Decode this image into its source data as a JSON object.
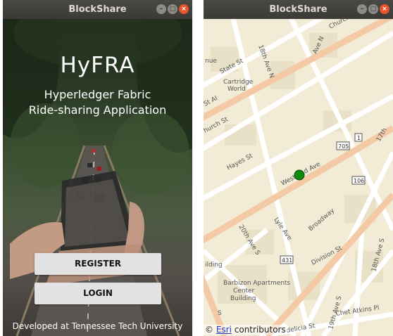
{
  "left_window": {
    "title": "BlockShare",
    "app_title": "HyFRA",
    "subtitle_line1": "Hyperledger Fabric",
    "subtitle_line2": "Ride-sharing Application",
    "register_label": "REGISTER",
    "login_label": "LOGIN",
    "footer": "Developed at Tennessee Tech University"
  },
  "right_window": {
    "title": "BlockShare",
    "attribution_prefix": "©",
    "attribution_link": "Esri",
    "attribution_suffix": "contributors",
    "map_labels": {
      "church_top": "Church",
      "ave_n_top": "Ave N",
      "nue": "nue",
      "state_st": "State St",
      "n18_ave": "18th Ave N",
      "cartridge": "Cartridge",
      "world": "World",
      "st_al": "St Al",
      "church_st": "hurch St",
      "n17": "17th",
      "hayes_st": "Hayes St",
      "west_end_ave": "West End Ave",
      "badge_705": "705",
      "badge_1": "1",
      "badge_106": "106",
      "broadway": "Broadway",
      "lyle_ave": "Lyle Ave",
      "ave_s_20th": "20th Ave S",
      "badge_431": "431",
      "division_st": "Division St",
      "ave_s_18th": "18th Ave S",
      "ilding": "ilding",
      "barbizon1": "Barbizon Apartments",
      "barbizon2": "Center",
      "barbizon3": "Building",
      "chet_atkins": "Chet Atkins Pl",
      "ave_s_19th": "19th Ave S",
      "delicia": "delicia St",
      "s_bottom": "S"
    },
    "colors": {
      "marker": "#0e8a0e",
      "arterial": "#f3c9a6",
      "road": "#ffffff",
      "building": "#e8e1c8"
    }
  }
}
